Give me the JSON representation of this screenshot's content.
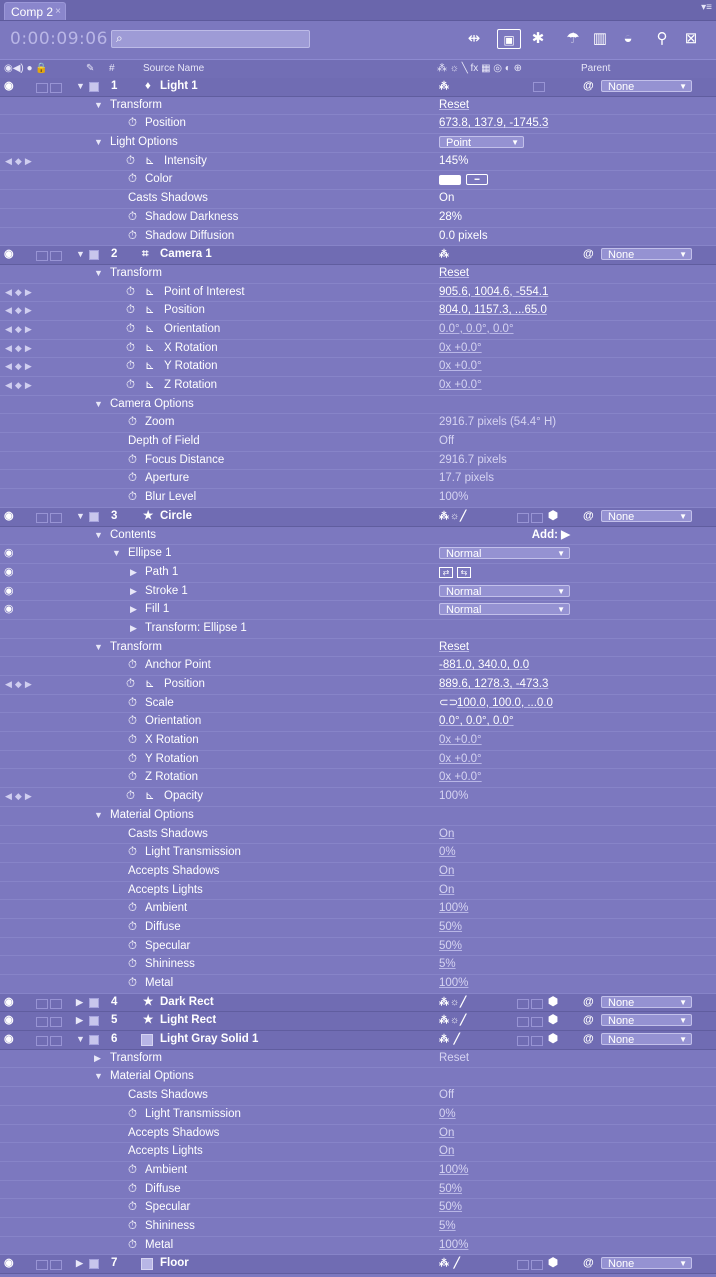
{
  "tab": {
    "label": "Comp 2"
  },
  "toolbar": {
    "timecode": "0:00:09:06",
    "search_placeholder": ""
  },
  "header": {
    "source_name": "Source Name",
    "number": "#",
    "parent": "Parent"
  },
  "labels": {
    "transform": "Transform",
    "position": "Position",
    "light_options": "Light Options",
    "intensity": "Intensity",
    "color": "Color",
    "casts_shadows": "Casts Shadows",
    "shadow_darkness": "Shadow Darkness",
    "shadow_diffusion": "Shadow Diffusion",
    "point_of_interest": "Point of Interest",
    "orientation": "Orientation",
    "x_rotation": "X Rotation",
    "y_rotation": "Y Rotation",
    "z_rotation": "Z Rotation",
    "camera_options": "Camera Options",
    "zoom": "Zoom",
    "depth_of_field": "Depth of Field",
    "focus_distance": "Focus Distance",
    "aperture": "Aperture",
    "blur_level": "Blur Level",
    "contents": "Contents",
    "add": "Add:",
    "ellipse_1": "Ellipse 1",
    "path_1": "Path 1",
    "stroke_1": "Stroke 1",
    "fill_1": "Fill 1",
    "transform_ellipse": "Transform: Ellipse 1",
    "anchor_point": "Anchor Point",
    "scale": "Scale",
    "opacity": "Opacity",
    "material_options": "Material Options",
    "light_transmission": "Light Transmission",
    "accepts_shadows": "Accepts Shadows",
    "accepts_lights": "Accepts Lights",
    "ambient": "Ambient",
    "diffuse": "Diffuse",
    "specular": "Specular",
    "shininess": "Shininess",
    "metal": "Metal",
    "reset": "Reset",
    "none": "None",
    "normal": "Normal",
    "point": "Point"
  },
  "layers": {
    "l1": {
      "num": "1",
      "name": "Light 1"
    },
    "l2": {
      "num": "2",
      "name": "Camera 1"
    },
    "l3": {
      "num": "3",
      "name": "Circle"
    },
    "l4": {
      "num": "4",
      "name": "Dark Rect"
    },
    "l5": {
      "num": "5",
      "name": "Light Rect"
    },
    "l6": {
      "num": "6",
      "name": "Light Gray Solid 1"
    },
    "l7": {
      "num": "7",
      "name": "Floor"
    }
  },
  "values": {
    "light_position": "673.8, 137.9, -1745.3",
    "intensity": "145%",
    "casts_shadows_on": "On",
    "shadow_darkness": "28%",
    "shadow_diffusion": "0.0 pixels",
    "cam_poi": "905.6, 1004.6, -554.1",
    "cam_position": "804.0, 1157.3, ...65.0",
    "cam_orientation": "0.0°, 0.0°, 0.0°",
    "rot_zero": "0x +0.0°",
    "zoom": "2916.7 pixels (54.4° H)",
    "depth_of_field": "Off",
    "focus_distance": "2916.7 pixels",
    "aperture": "17.7 pixels",
    "blur_level": "100%",
    "anchor_point": "-881.0, 340.0, 0.0",
    "circle_position": "889.6, 1278.3, -473.3",
    "scale": "100.0, 100.0, ...0.0",
    "opacity": "100%",
    "on": "On",
    "off": "Off",
    "zero_pct": "0%",
    "hundred_pct": "100%",
    "fifty_pct": "50%",
    "five_pct": "5%"
  }
}
